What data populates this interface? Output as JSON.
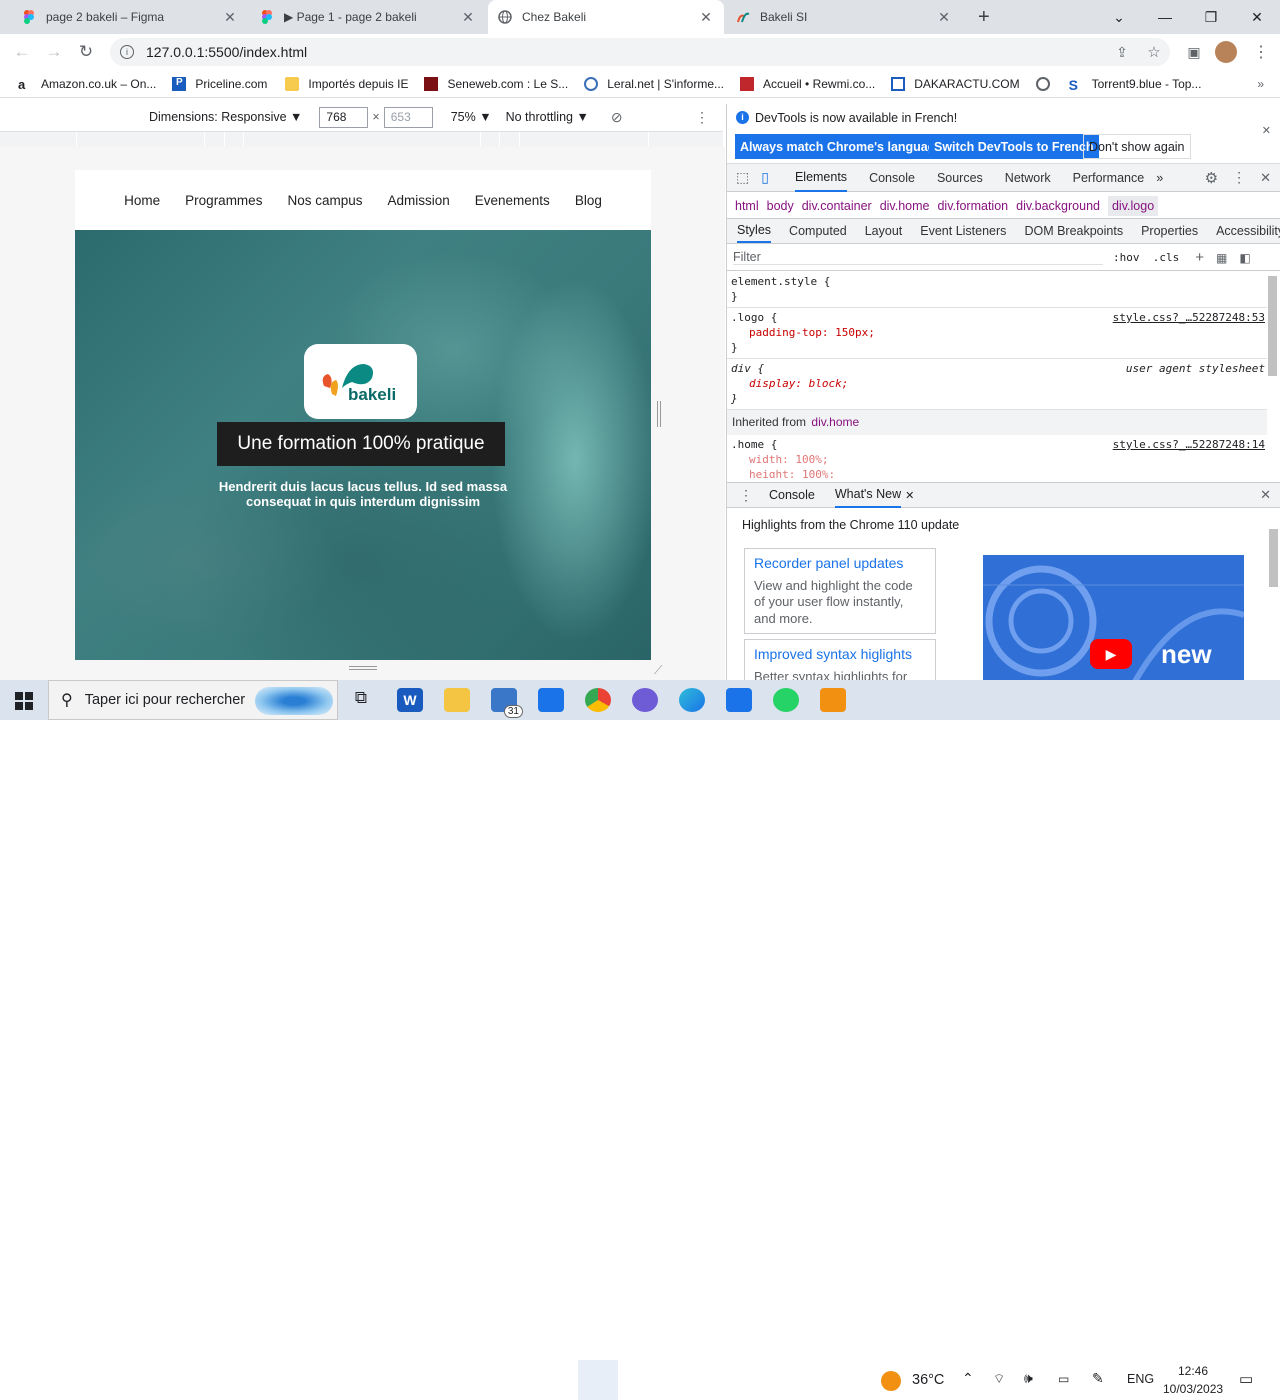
{
  "tabs": [
    {
      "title": "page 2 bakeli – Figma"
    },
    {
      "title": "▶ Page 1 - page 2 bakeli"
    },
    {
      "title": "Chez Bakeli"
    },
    {
      "title": "Bakeli SI"
    }
  ],
  "address": {
    "url": "127.0.0.1:5500/index.html"
  },
  "bookmarks": [
    "Amazon.co.uk – On...",
    "Priceline.com",
    "Importés depuis IE",
    "Seneweb.com : Le S...",
    "Leral.net | S'informe...",
    "Accueil • Rewmi.co...",
    "DAKARACTU.COM",
    "Torrent9.blue - Top..."
  ],
  "device_toolbar": {
    "dimensions_label": "Dimensions: Responsive ▼",
    "width": "768",
    "height": "653",
    "zoom": "75% ▼",
    "throttling": "No throttling ▼"
  },
  "site": {
    "nav": [
      "Home",
      "Programmes",
      "Nos campus",
      "Admission",
      "Evenements",
      "Blog"
    ],
    "logo_text": "bakeli",
    "tagline": "Une formation 100% pratique",
    "subtext": "Hendrerit duis lacus lacus tellus. Id sed massa consequat in quis interdum dignissim"
  },
  "devtools": {
    "info_text": "DevTools is now available in French!",
    "btn_match": "Always match Chrome's language",
    "btn_switch": "Switch DevTools to French",
    "btn_dismiss": "Don't show again",
    "tabs": [
      "Elements",
      "Console",
      "Sources",
      "Network",
      "Performance",
      "»"
    ],
    "breadcrumbs": [
      "html",
      "body",
      "div.container",
      "div.home",
      "div.formation",
      "div.background",
      "div.logo"
    ],
    "subtabs": [
      "Styles",
      "Computed",
      "Layout",
      "Event Listeners",
      "DOM Breakpoints",
      "Properties",
      "Accessibility"
    ],
    "filter_placeholder": "Filter",
    "filter_tools": ":hov  .cls",
    "rules": [
      {
        "selector": "element.style {",
        "source": "",
        "props": [],
        "close": "}"
      },
      {
        "selector": ".logo {",
        "source": "style.css?_…52287248:53",
        "props": [
          "padding-top: 150px;"
        ],
        "close": "}"
      },
      {
        "selector": "div {",
        "source": "user agent stylesheet",
        "props": [
          "display: block;"
        ],
        "close": "}"
      }
    ],
    "inherited_label": "Inherited from",
    "inherited_from": "div.home",
    "home_rule": {
      "selector": ".home {",
      "source": "style.css?_…52287248:14",
      "props": [
        "width: 100%;",
        "height: 100%;"
      ]
    },
    "drawer_tabs": [
      "Console",
      "What's New"
    ],
    "drawer_heading": "Highlights from the Chrome 110 update",
    "cards": [
      {
        "title": "Recorder panel updates",
        "body": "View and highlight the code of your user flow instantly, and more."
      },
      {
        "title": "Improved syntax higlights",
        "body": "Better syntax highlights for"
      }
    ],
    "video_label": "new"
  },
  "taskbar": {
    "search_placeholder": "Taper ici pour rechercher",
    "mail_badge": "31",
    "weather": "36°C",
    "lang": "ENG",
    "time": "12:46",
    "date": "10/03/2023"
  }
}
